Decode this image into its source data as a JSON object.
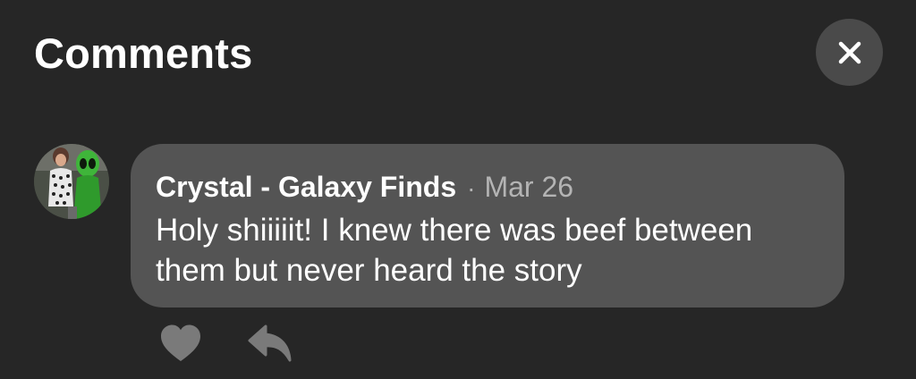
{
  "header": {
    "title": "Comments",
    "close_icon": "close-icon"
  },
  "comment": {
    "avatar_icon": "user-avatar-photo",
    "author": "Crystal - Galaxy Finds",
    "separator": "·",
    "date": "Mar 26",
    "text": "Holy shiiiiit! I knew there was beef between them but never heard the story",
    "actions": {
      "like_icon": "heart-icon",
      "reply_icon": "reply-arrow-icon"
    }
  },
  "colors": {
    "background": "#262626",
    "bubble": "#545454",
    "close_button_bg": "#4a4a4a",
    "icon_gray": "#7a7a7a",
    "secondary_text": "#b4b4b4"
  }
}
